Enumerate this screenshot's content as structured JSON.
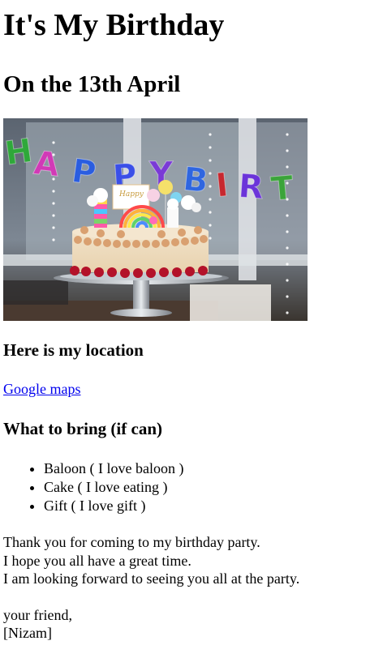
{
  "page": {
    "title": "It's My Birthday",
    "subtitle": "On the 13th April",
    "location_heading": "Here is my location",
    "map_link": "Google maps",
    "bring_heading": "What to bring (if can)",
    "bring_items": [
      "Baloon ( I love baloon )",
      "Cake ( I love eating )",
      "Gift ( I love gift )"
    ],
    "thanks_lines": [
      "Thank you for coming to my birthday party.",
      "I hope you all have a great time.",
      "I am looking forward to seeing you all at the party."
    ],
    "closing": "your friend,",
    "signature": "[Nizam]"
  },
  "image": {
    "balloon_letters": "HAPPY BIRT",
    "cake_topper": "Happy"
  }
}
